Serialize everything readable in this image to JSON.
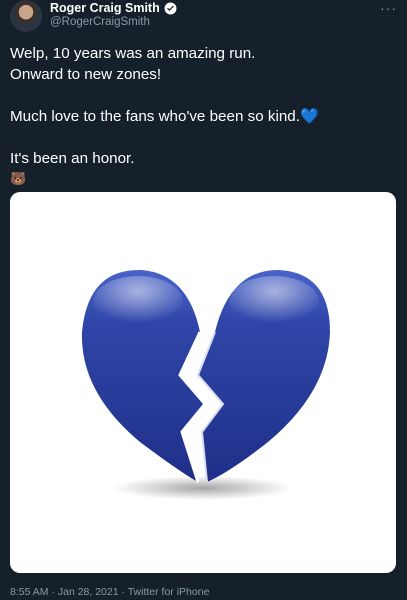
{
  "author": {
    "name": "Roger Craig Smith",
    "handle": "@RogerCraigSmith",
    "verified_icon": "verified-badge-icon",
    "more_icon": "more-icon",
    "more_text": "···"
  },
  "tweet": {
    "line1": "Welp, 10 years was an amazing run.",
    "line2": "Onward to new zones!",
    "line3": "Much love to the fans who've been so kind.",
    "line3_emoji": "💙",
    "line4": "It's been an honor.",
    "line5_emoji": "🐻"
  },
  "media": {
    "description_icon": "broken-heart-icon",
    "heart_color": "#2b3f9c"
  },
  "footer": {
    "timestamp": "8:55 AM · Jan 28, 2021 · Twitter for iPhone"
  },
  "colors": {
    "background": "#15202b",
    "secondary_text": "#8899a6",
    "verified": "#1da1f2"
  }
}
